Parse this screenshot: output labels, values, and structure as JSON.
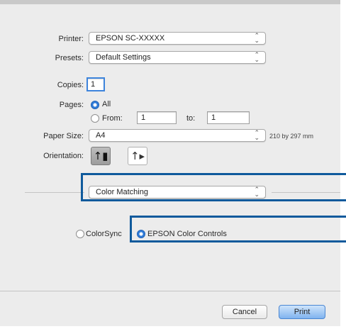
{
  "printer": {
    "label": "Printer:",
    "value": "EPSON SC-XXXXX"
  },
  "presets": {
    "label": "Presets:",
    "value": "Default Settings"
  },
  "copies": {
    "label": "Copies:",
    "value": "1"
  },
  "pages": {
    "label": "Pages:",
    "all_label": "All",
    "from_label": "From:",
    "from_value": "1",
    "to_label": "to:",
    "to_value": "1"
  },
  "paper_size": {
    "label": "Paper Size:",
    "value": "A4",
    "dimensions": "210 by 297 mm"
  },
  "orientation": {
    "label": "Orientation:"
  },
  "panel_menu": {
    "value": "Color Matching"
  },
  "color_options": {
    "colorsync_label": "ColorSync",
    "epson_label": "EPSON Color Controls"
  },
  "buttons": {
    "cancel": "Cancel",
    "print": "Print"
  },
  "popup_arrows": "⌃⌄",
  "colors": {
    "highlight": "#0f5a9c",
    "accent": "#2f7bd8"
  }
}
